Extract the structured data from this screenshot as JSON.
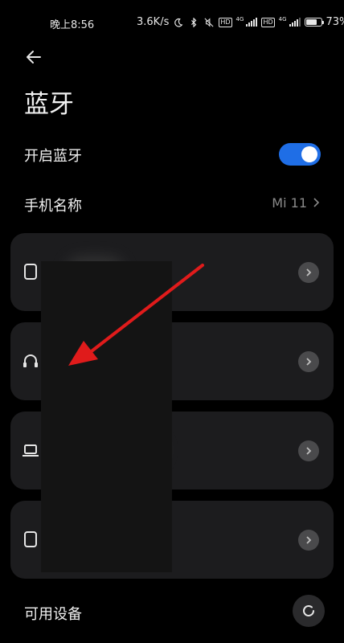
{
  "status_bar": {
    "time": "晚上8:56",
    "net_speed": "3.6K/s",
    "network_type_1": "4G",
    "network_type_2": "4G",
    "hd_badge": "HD",
    "battery_percent": "73%",
    "battery_level": 0.73,
    "icons": [
      "moon-icon",
      "bluetooth-icon",
      "mute-icon",
      "hd-icon",
      "signal-icon",
      "battery-icon"
    ]
  },
  "header": {
    "back_icon": "back-arrow-icon",
    "title": "蓝牙"
  },
  "settings": {
    "bluetooth_toggle_label": "开启蓝牙",
    "bluetooth_on": true,
    "device_name_label": "手机名称",
    "device_name_value": "Mi 11"
  },
  "paired_devices": [
    {
      "icon": "phone-icon",
      "name": ""
    },
    {
      "icon": "headphones-icon",
      "name": ""
    },
    {
      "icon": "laptop-icon",
      "name": ""
    },
    {
      "icon": "phone-icon",
      "name": ""
    }
  ],
  "available_section": {
    "label": "可用设备",
    "refresh_icon": "refresh-icon"
  },
  "colors": {
    "accent": "#1f6ee6",
    "background": "#000000",
    "card": "#1c1c1e",
    "annotation_arrow": "#e01b1b"
  }
}
